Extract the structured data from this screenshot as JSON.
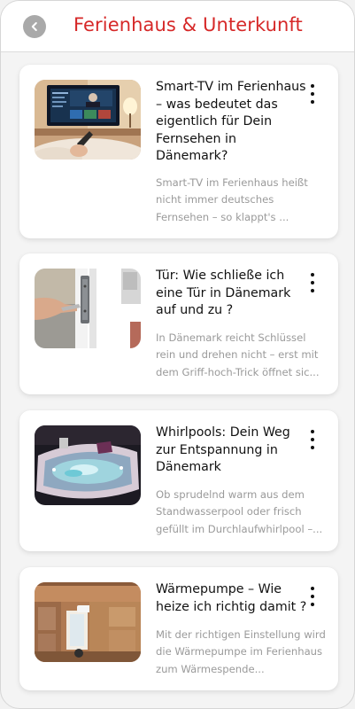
{
  "header": {
    "title": "Ferienhaus & Unterkunft",
    "back_icon": "chevron-left-icon"
  },
  "articles": [
    {
      "title": "Smart-TV im Ferienhaus – was bedeutet das eigentlich für Dein Fernsehen in Dänemark?",
      "excerpt": "Smart-TV im Ferienhaus heißt nicht immer deutsches Fernsehen – so klappt's ...",
      "thumbnail": "living-room-smart-tv-photo",
      "menu_icon": "more-vertical-icon"
    },
    {
      "title": "Tür: Wie schließe ich eine Tür in Dänemark auf und zu ?",
      "excerpt": "In Dänemark reicht Schlüssel rein und drehen nicht – erst mit dem Griff-hoch-Trick öffnet sic...",
      "thumbnail": "door-lock-key-photo",
      "menu_icon": "more-vertical-icon"
    },
    {
      "title": "Whirlpools: Dein Weg zur Entspannung in Dänemark",
      "excerpt": "Ob sprudelnd warm aus dem Standwasserpool oder frisch gefüllt im Durchlaufwhirlpool –...",
      "thumbnail": "whirlpool-tub-photo",
      "menu_icon": "more-vertical-icon"
    },
    {
      "title": "Wärmepumpe – Wie heize ich richtig damit ?",
      "excerpt": "Mit der richtigen Einstellung wird die Wärmepumpe im Ferienhaus zum Wärmespende...",
      "thumbnail": "kitchen-heat-pump-photo",
      "menu_icon": "more-vertical-icon"
    }
  ]
}
